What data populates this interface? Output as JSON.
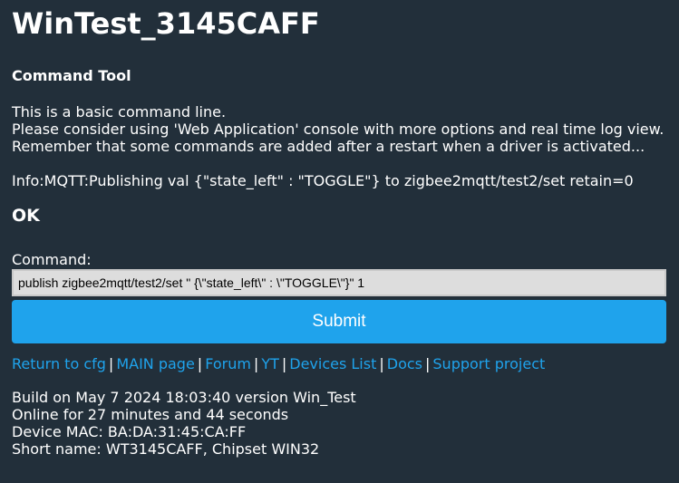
{
  "page": {
    "title": "WinTest_3145CAFF",
    "subtitle": "Command Tool"
  },
  "intro": {
    "line1": "This is a basic command line.",
    "line2": "Please consider using 'Web Application' console with more options and real time log view.",
    "line3": "Remember that some commands are added after a restart when a driver is activated..."
  },
  "result": {
    "info": "Info:MQTT:Publishing val {\"state_left\" : \"TOGGLE\"} to zigbee2mqtt/test2/set retain=0",
    "status": "OK"
  },
  "command": {
    "label": "Command:",
    "value": "publish zigbee2mqtt/test2/set \" {\\\"state_left\\\" : \\\"TOGGLE\\\"}\" 1",
    "submit_label": "Submit"
  },
  "links": {
    "return_cfg": "Return to cfg",
    "main_page": "MAIN page",
    "forum": "Forum",
    "yt": "YT",
    "devices_list": "Devices List",
    "docs": "Docs",
    "support_project": "Support project",
    "separator": "|"
  },
  "build": {
    "built": "Build on May 7 2024 18:03:40 version Win_Test",
    "online": "Online for 27 minutes and 44 seconds",
    "mac": "Device MAC: BA:DA:31:45:CA:FF",
    "short_name": "Short name: WT3145CAFF, Chipset WIN32"
  },
  "colors": {
    "background": "#222f3a",
    "accent": "#1fa3ec",
    "input_background": "#dddddd"
  }
}
